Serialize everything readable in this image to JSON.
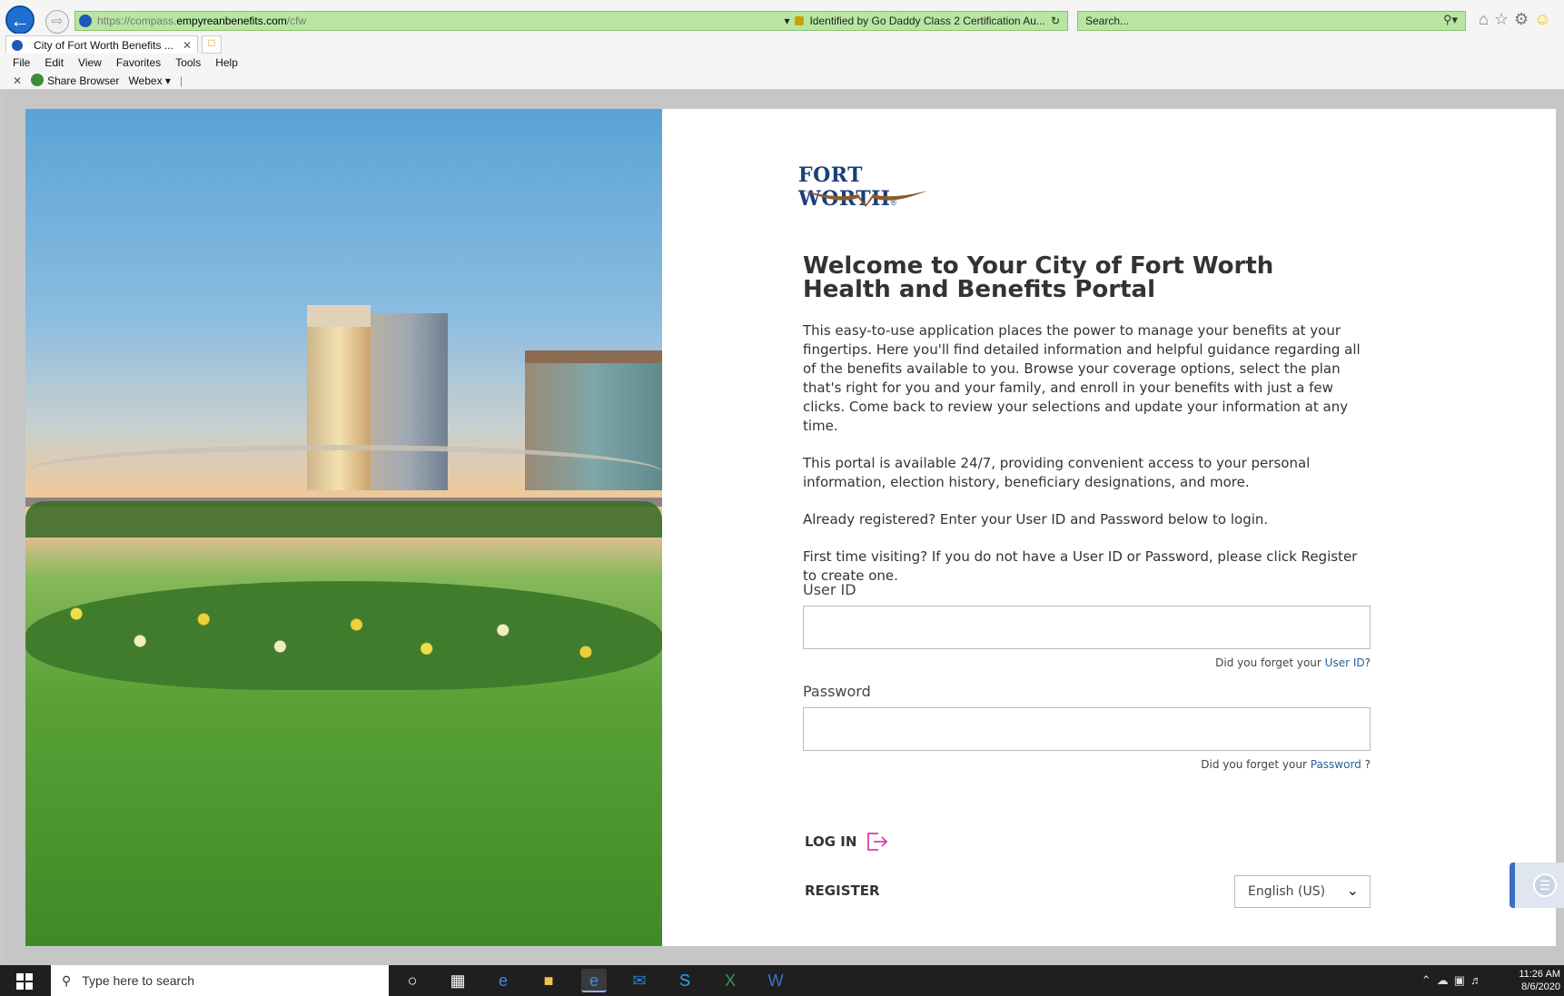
{
  "browser": {
    "url_prefix": "https://compass.",
    "url_host": "empyreanbenefits.com",
    "url_path": "/cfw",
    "certificate": "Identified by Go Daddy Class 2 Certification Au...",
    "search_placeholder": "Search...",
    "tab_title": "City of Fort Worth Benefits ...",
    "menu": [
      "File",
      "Edit",
      "View",
      "Favorites",
      "Tools",
      "Help"
    ],
    "favorites": {
      "share_browser": "Share Browser",
      "webex": "Webex"
    }
  },
  "logo": {
    "text": "FORT WORTH",
    "registered": "®"
  },
  "content": {
    "title_line1": "Welcome to Your City of Fort Worth",
    "title_line2": "Health and Benefits Portal",
    "para1": "This easy-to-use application places the power to manage your benefits at your fingertips. Here you'll find detailed information and helpful guidance regarding all of the benefits available to you. Browse your coverage options, select the plan that's right for you and your family, and enroll in your benefits with just a few clicks. Come back to review your selections and update your information at any time.",
    "para2": "This portal is available 24/7, providing convenient access to your personal information, election history, beneficiary designations, and more.",
    "para3": "Already registered? Enter your User ID and Password below to login.",
    "para4": "First time visiting? If you do not have a User ID or Password, please click Register to create one."
  },
  "form": {
    "userid_label": "User ID",
    "userid_value": "",
    "userid_forgot_prefix": "Did you forget your",
    "userid_forgot_link": "User ID",
    "userid_forgot_suffix": "?",
    "password_label": "Password",
    "password_value": "",
    "password_forgot_prefix": "Did you forget your",
    "password_forgot_link": "Password",
    "password_forgot_suffix": " ?",
    "login_label": "LOG IN",
    "register_label": "REGISTER",
    "language": "English (US)"
  },
  "taskbar": {
    "search_placeholder": "Type here to search",
    "time": "11:26 AM",
    "date": "8/6/2020"
  },
  "colors": {
    "url_bar_bg": "#b8e6a2",
    "title_text": "#333333",
    "link": "#2a5f9e",
    "login_icon": "#d63fae",
    "logo_blue": "#1b3f7a",
    "chat_accent": "#3b6fc0"
  }
}
